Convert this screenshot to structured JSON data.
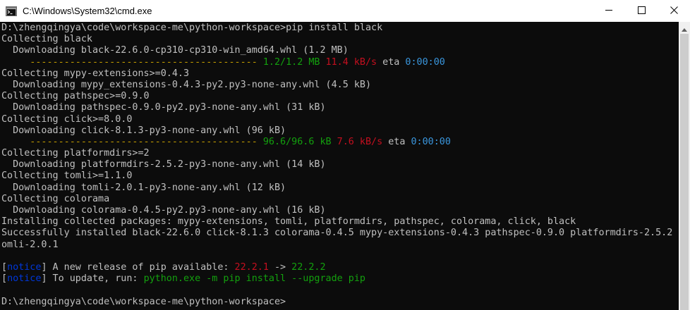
{
  "window": {
    "title": "C:\\Windows\\System32\\cmd.exe",
    "icons": {
      "app": "cmd-icon",
      "minimize": "minimize-icon",
      "maximize": "maximize-icon",
      "close": "close-icon"
    }
  },
  "console": {
    "lines": [
      [
        {
          "t": "D:\\zhengqingya\\code\\workspace-me\\python-workspace>pip install black",
          "c": ""
        }
      ],
      [
        {
          "t": "Collecting black",
          "c": ""
        }
      ],
      [
        {
          "t": "  Downloading black-22.6.0-cp310-cp310-win_amd64.whl (1.2 MB)",
          "c": ""
        }
      ],
      [
        {
          "t": "     ---------------------------------------- ",
          "c": "orange"
        },
        {
          "t": "1.2/1.2 MB",
          "c": "green"
        },
        {
          "t": " ",
          "c": ""
        },
        {
          "t": "11.4 kB/s",
          "c": "red"
        },
        {
          "t": " eta ",
          "c": ""
        },
        {
          "t": "0:00:00",
          "c": "cyan"
        }
      ],
      [
        {
          "t": "Collecting mypy-extensions>=0.4.3",
          "c": ""
        }
      ],
      [
        {
          "t": "  Downloading mypy_extensions-0.4.3-py2.py3-none-any.whl (4.5 kB)",
          "c": ""
        }
      ],
      [
        {
          "t": "Collecting pathspec>=0.9.0",
          "c": ""
        }
      ],
      [
        {
          "t": "  Downloading pathspec-0.9.0-py2.py3-none-any.whl (31 kB)",
          "c": ""
        }
      ],
      [
        {
          "t": "Collecting click>=8.0.0",
          "c": ""
        }
      ],
      [
        {
          "t": "  Downloading click-8.1.3-py3-none-any.whl (96 kB)",
          "c": ""
        }
      ],
      [
        {
          "t": "     ---------------------------------------- ",
          "c": "orange"
        },
        {
          "t": "96.6/96.6 kB",
          "c": "green"
        },
        {
          "t": " ",
          "c": ""
        },
        {
          "t": "7.6 kB/s",
          "c": "red"
        },
        {
          "t": " eta ",
          "c": ""
        },
        {
          "t": "0:00:00",
          "c": "cyan"
        }
      ],
      [
        {
          "t": "Collecting platformdirs>=2",
          "c": ""
        }
      ],
      [
        {
          "t": "  Downloading platformdirs-2.5.2-py3-none-any.whl (14 kB)",
          "c": ""
        }
      ],
      [
        {
          "t": "Collecting tomli>=1.1.0",
          "c": ""
        }
      ],
      [
        {
          "t": "  Downloading tomli-2.0.1-py3-none-any.whl (12 kB)",
          "c": ""
        }
      ],
      [
        {
          "t": "Collecting colorama",
          "c": ""
        }
      ],
      [
        {
          "t": "  Downloading colorama-0.4.5-py2.py3-none-any.whl (16 kB)",
          "c": ""
        }
      ],
      [
        {
          "t": "Installing collected packages: mypy-extensions, tomli, platformdirs, pathspec, colorama, click, black",
          "c": ""
        }
      ],
      [
        {
          "t": "Successfully installed black-22.6.0 click-8.1.3 colorama-0.4.5 mypy-extensions-0.4.3 pathspec-0.9.0 platformdirs-2.5.2 t",
          "c": ""
        }
      ],
      [
        {
          "t": "omli-2.0.1",
          "c": ""
        }
      ],
      [
        {
          "t": "",
          "c": ""
        }
      ],
      [
        {
          "t": "[",
          "c": ""
        },
        {
          "t": "notice",
          "c": "blue"
        },
        {
          "t": "] A new release of pip available: ",
          "c": ""
        },
        {
          "t": "22.2.1",
          "c": "red"
        },
        {
          "t": " -> ",
          "c": ""
        },
        {
          "t": "22.2.2",
          "c": "green"
        }
      ],
      [
        {
          "t": "[",
          "c": ""
        },
        {
          "t": "notice",
          "c": "blue"
        },
        {
          "t": "] To update, run: ",
          "c": ""
        },
        {
          "t": "python.exe -m pip install --upgrade pip",
          "c": "green"
        }
      ],
      [
        {
          "t": "",
          "c": ""
        }
      ],
      [
        {
          "t": "D:\\zhengqingya\\code\\workspace-me\\python-workspace>",
          "c": ""
        }
      ]
    ]
  },
  "colors": {
    "background": "#0c0c0c",
    "text": "#c0c0c0",
    "green": "#13a10e",
    "red": "#c50f1f",
    "cyan": "#3a96dd",
    "blue": "#0037da",
    "orange": "#c19c00"
  },
  "scrollbar": {
    "up": "scroll-up-arrow-icon",
    "down": "scroll-down-arrow-icon"
  }
}
